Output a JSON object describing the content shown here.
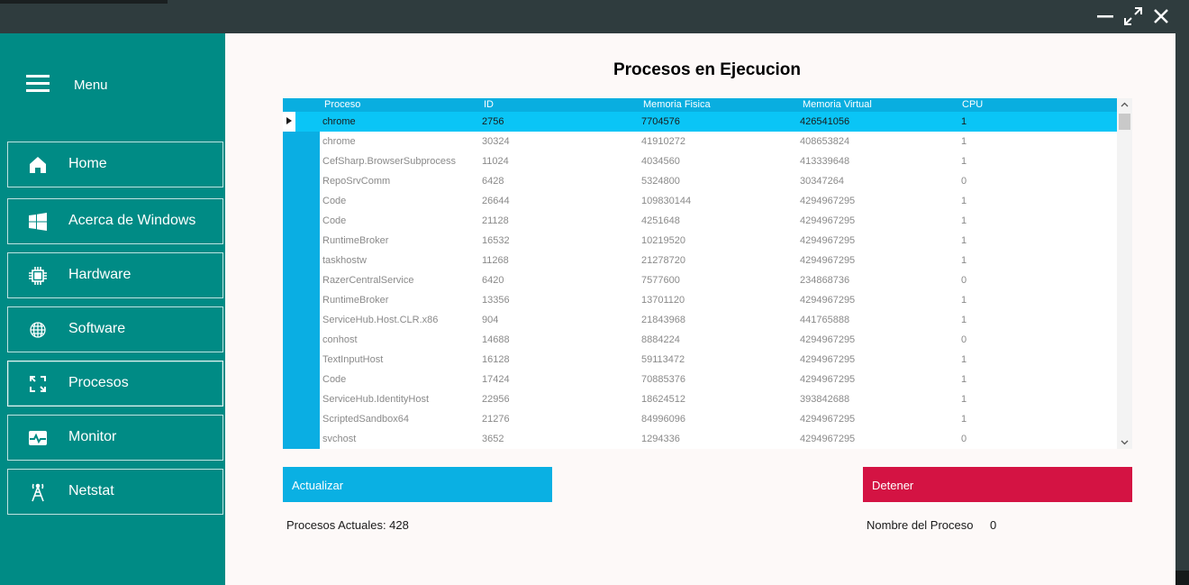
{
  "window": {
    "minimize": "minimize-icon",
    "maximize": "maximize-icon",
    "close": "close-icon"
  },
  "sidebar": {
    "menu_label": "Menu",
    "items": [
      {
        "label": "Home",
        "icon": "home-icon"
      },
      {
        "label": "Acerca de Windows",
        "icon": "windows-icon"
      },
      {
        "label": "Hardware",
        "icon": "chip-icon"
      },
      {
        "label": "Software",
        "icon": "globe-icon"
      },
      {
        "label": "Procesos",
        "icon": "refresh-icon"
      },
      {
        "label": "Monitor",
        "icon": "pulse-icon"
      },
      {
        "label": "Netstat",
        "icon": "antenna-icon"
      }
    ],
    "active_item": "Procesos"
  },
  "main": {
    "title": "Procesos en Ejecucion",
    "table": {
      "columns": [
        "Proceso",
        "ID",
        "Memoria Fisica",
        "Memoria Virtual",
        "CPU"
      ],
      "rows": [
        [
          "chrome",
          "2756",
          "7704576",
          "426541056",
          "1"
        ],
        [
          "chrome",
          "30324",
          "41910272",
          "408653824",
          "1"
        ],
        [
          "CefSharp.BrowserSubprocess",
          "11024",
          "4034560",
          "413339648",
          "1"
        ],
        [
          "RepoSrvComm",
          "6428",
          "5324800",
          "30347264",
          "0"
        ],
        [
          "Code",
          "26644",
          "109830144",
          "4294967295",
          "1"
        ],
        [
          "Code",
          "21128",
          "4251648",
          "4294967295",
          "1"
        ],
        [
          "RuntimeBroker",
          "16532",
          "10219520",
          "4294967295",
          "1"
        ],
        [
          "taskhostw",
          "11268",
          "21278720",
          "4294967295",
          "1"
        ],
        [
          "RazerCentralService",
          "6420",
          "7577600",
          "234868736",
          "0"
        ],
        [
          "RuntimeBroker",
          "13356",
          "13701120",
          "4294967295",
          "1"
        ],
        [
          "ServiceHub.Host.CLR.x86",
          "904",
          "21843968",
          "441765888",
          "1"
        ],
        [
          "conhost",
          "14688",
          "8884224",
          "4294967295",
          "0"
        ],
        [
          "TextInputHost",
          "16128",
          "59113472",
          "4294967295",
          "1"
        ],
        [
          "Code",
          "17424",
          "70885376",
          "4294967295",
          "1"
        ],
        [
          "ServiceHub.IdentityHost",
          "22956",
          "18624512",
          "393842688",
          "1"
        ],
        [
          "ScriptedSandbox64",
          "21276",
          "84996096",
          "4294967295",
          "1"
        ],
        [
          "svchost",
          "3652",
          "1294336",
          "4294967295",
          "0"
        ]
      ]
    },
    "update_button": "Actualizar",
    "stop_button": "Detener",
    "process_count_label": "Procesos Actuales: 428",
    "process_name_label": "Nombre del Proceso",
    "process_name_value": "0"
  },
  "colors": {
    "sidebar": "#008b85",
    "accent_blue": "#0ab0e3",
    "selected_row": "#0ac5f6",
    "stop_red": "#d41343"
  }
}
